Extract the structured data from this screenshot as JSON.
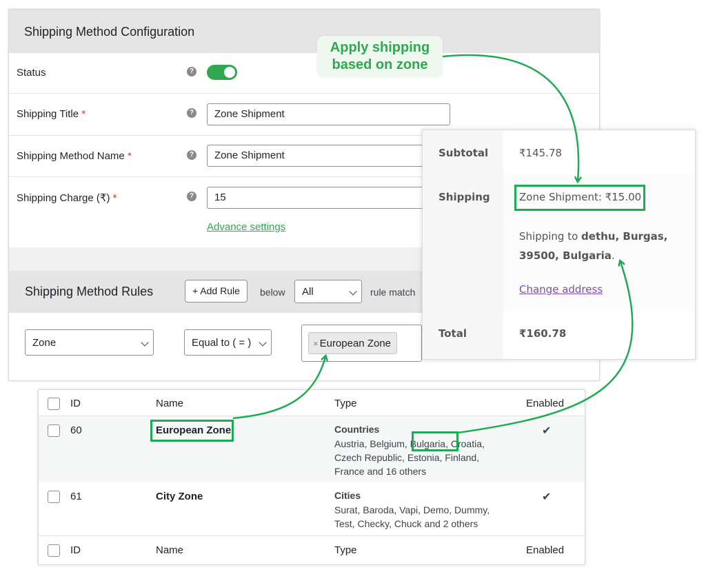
{
  "config": {
    "title": "Shipping Method Configuration",
    "status_label": "Status",
    "status_on": true,
    "shipping_title_label": "Shipping Title",
    "shipping_title_value": "Zone Shipment",
    "method_name_label": "Shipping Method Name",
    "method_name_value": "Zone Shipment",
    "charge_label": "Shipping Charge (₹)",
    "charge_value": "15",
    "required_mark": "*",
    "help_glyph": "?",
    "advance_link": "Advance settings"
  },
  "rules": {
    "title": "Shipping Method Rules",
    "add_rule_label": "+ Add Rule",
    "below_text": "below",
    "match_select": "All",
    "rule_match_text": "rule match",
    "condition_select": "Zone",
    "operator_select": "Equal to ( = )",
    "chip_remove": "×",
    "chip_value": "European Zone"
  },
  "callout": {
    "line1": "Apply shipping",
    "line2": "based on zone"
  },
  "cart": {
    "subtotal_label": "Subtotal",
    "subtotal_value": "₹145.78",
    "shipping_label": "Shipping",
    "shipping_value": "Zone Shipment: ₹15.00",
    "shipping_to_prefix": "Shipping to ",
    "shipping_to_address": "dethu, Burgas, 39500, Bulgaria",
    "shipping_to_suffix": ".",
    "change_address": "Change address",
    "total_label": "Total",
    "total_value": "₹160.78"
  },
  "zones_table": {
    "headers": {
      "id": "ID",
      "name": "Name",
      "type": "Type",
      "enabled": "Enabled"
    },
    "rows": [
      {
        "id": "60",
        "name": "European Zone",
        "type": "Countries",
        "desc_line1_a": "Austria, Belgium, ",
        "desc_line1_hl": "Bulgaria,",
        "desc_line1_b": " Croatia,",
        "desc_line2": "Czech Republic, Estonia, Finland,",
        "desc_line3": "France and 16 others",
        "enabled": "✔"
      },
      {
        "id": "61",
        "name": "City Zone",
        "type": "Cities",
        "desc_line1": "Surat, Baroda, Vapi, Demo, Dummy,",
        "desc_line2": "Test, Checky, Chuck and 2 others",
        "enabled": "✔"
      }
    ]
  },
  "colors": {
    "accent": "#2fa84f",
    "highlight_border": "#1faa54",
    "link_purple": "#7b4fa8"
  }
}
